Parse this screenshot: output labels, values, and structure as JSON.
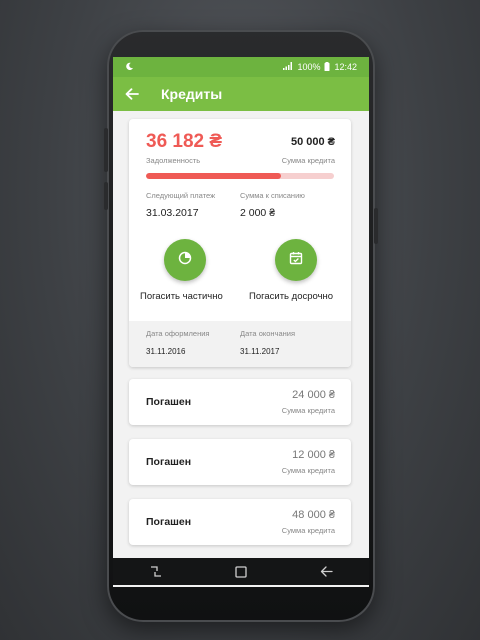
{
  "status_bar": {
    "battery": "100%",
    "time": "12:42"
  },
  "app_bar": {
    "title": "Кредиты"
  },
  "credit": {
    "debt": "36 182 ₴",
    "debt_label": "Задолженность",
    "amount": "50 000 ₴",
    "amount_label": "Сумма кредита",
    "progress": 0.72,
    "next_payment_label": "Следующий платеж",
    "next_payment_date": "31.03.2017",
    "charge_label": "Сумма к списанию",
    "charge_amount": "2 000 ₴",
    "partial_repay_label": "Погасить частично",
    "early_repay_label": "Погасить досрочно",
    "issue_date_label": "Дата оформления",
    "issue_date": "31.11.2016",
    "end_date_label": "Дата окончания",
    "end_date": "31.11.2017"
  },
  "paid_credits": [
    {
      "status": "Погашен",
      "amount": "24 000 ₴",
      "amount_label": "Сумма кредита"
    },
    {
      "status": "Погашен",
      "amount": "12 000 ₴",
      "amount_label": "Сумма кредита"
    },
    {
      "status": "Погашен",
      "amount": "48 000 ₴",
      "amount_label": "Сумма кредита"
    }
  ],
  "icons": {
    "back": "arrow-left-icon",
    "partial": "pie-chart-icon",
    "early": "calendar-check-icon",
    "nav_recent": "recent-apps-icon",
    "nav_home": "home-icon",
    "nav_back": "back-icon"
  },
  "colors": {
    "primary": "#7bbe44",
    "status_bar": "#6db33f",
    "debt": "#ef5a55",
    "progress_track": "#f6cfcf"
  }
}
